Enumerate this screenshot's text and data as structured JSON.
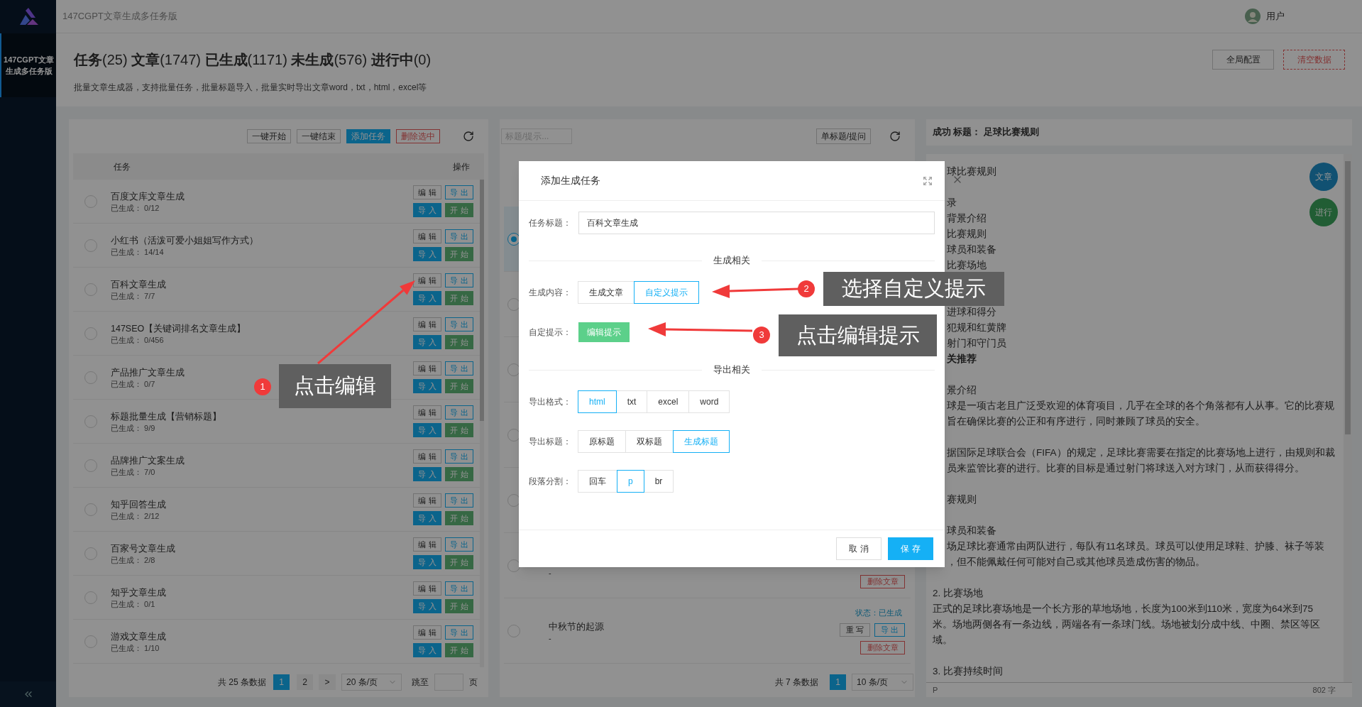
{
  "sidebar": {
    "items": [
      {
        "label": "147CGPT文章生成多任务版",
        "selected": true
      }
    ]
  },
  "topbar": {
    "title": "147CGPT文章生成多任务版",
    "user": "用户"
  },
  "header": {
    "stats": "**任务**(25) **文章**(1747) **已生成**(1171) **未生成**(576) **进行中**(0)",
    "description": "批量文章生成器，支持批量任务，批量标题导入，批量实时导出文章word，txt，html，excel等",
    "buttons": [
      {
        "label": "全局配置",
        "kind": "default"
      },
      {
        "label": "清空数据",
        "kind": "danger"
      }
    ]
  },
  "task_panel": {
    "toolbar": [
      {
        "label": "一键开始",
        "kind": "default"
      },
      {
        "label": "一键结束",
        "kind": "default"
      },
      {
        "label": "添加任务",
        "kind": "primary"
      },
      {
        "label": "删除选中",
        "kind": "danger"
      }
    ],
    "columns": [
      "任务",
      "操作"
    ],
    "rows": [
      {
        "name": "百度文库文章生成",
        "progress": "已生成： 0/12",
        "selected": false,
        "actions": [
          "编 辑",
          "导 出",
          "导 入",
          "开 始"
        ]
      },
      {
        "name": "小红书（活泼可爱小姐姐写作方式）",
        "progress": "已生成： 14/14",
        "selected": false,
        "actions": [
          "编 辑",
          "导 出",
          "导 入",
          "开 始"
        ]
      },
      {
        "name": "百科文章生成",
        "progress": "已生成： 7/7",
        "selected": false,
        "actions": [
          "编 辑",
          "导 出",
          "导 入",
          "开 始"
        ]
      },
      {
        "name": "147SEO【关键词排名文章生成】",
        "progress": "已生成： 0/456",
        "selected": false,
        "actions": [
          "编 辑",
          "导 出",
          "导 入",
          "开 始"
        ]
      },
      {
        "name": "产品推广文章生成",
        "progress": "已生成： 0/7",
        "selected": false,
        "actions": [
          "编 辑",
          "导 出",
          "导 入",
          "开 始"
        ]
      },
      {
        "name": "标题批量生成【营销标题】",
        "progress": "已生成： 9/9",
        "selected": false,
        "actions": [
          "编 辑",
          "导 出",
          "导 入",
          "开 始"
        ]
      },
      {
        "name": "品牌推广文案生成",
        "progress": "已生成： 7/0",
        "selected": false,
        "actions": [
          "编 辑",
          "导 出",
          "导 入",
          "开 始"
        ]
      },
      {
        "name": "知乎回答生成",
        "progress": "已生成： 2/12",
        "selected": false,
        "actions": [
          "编 辑",
          "导 出",
          "导 入",
          "开 始"
        ]
      },
      {
        "name": "百家号文章生成",
        "progress": "已生成： 2/8",
        "selected": false,
        "actions": [
          "编 辑",
          "导 出",
          "导 入",
          "开 始"
        ]
      },
      {
        "name": "知乎文章生成",
        "progress": "已生成： 0/1",
        "selected": false,
        "actions": [
          "编 辑",
          "导 出",
          "导 入",
          "开 始"
        ]
      },
      {
        "name": "游戏文章生成",
        "progress": "已生成： 1/10",
        "selected": false,
        "actions": [
          "编 辑",
          "导 出",
          "导 入",
          "开 始"
        ]
      }
    ],
    "pagination": {
      "total": "共 25 条数据",
      "pages": [
        {
          "label": "1",
          "selected": true
        },
        {
          "label": "2",
          "selected": false
        }
      ],
      "next": ">",
      "per_page": "20 条/页",
      "goto": "跳至",
      "suffix": "页"
    }
  },
  "article_panel": {
    "search": {
      "placeholder": "标题/提示..."
    },
    "button": "单标题/提问",
    "rows": [
      {
        "selected": true
      },
      {
        "selected": false
      },
      {
        "selected": false
      },
      {
        "selected": false
      },
      {
        "selected": false
      },
      {
        "selected": false,
        "subtitle": "-",
        "actions": [
          {
            "label": "删除文章",
            "kind": "delete"
          }
        ]
      },
      {
        "selected": false,
        "title": "中秋节的起源",
        "subtitle": "-",
        "status": "状态：已生成",
        "actions": [
          {
            "label": "重 写",
            "kind": "rewrite"
          },
          {
            "label": "导 出",
            "kind": "export"
          },
          {
            "label": "删除文章",
            "kind": "delete"
          }
        ]
      }
    ],
    "pagination": {
      "total": "共 7 条数据",
      "pages": [
        {
          "label": "1",
          "selected": true
        }
      ],
      "per_page": "10 条/页"
    }
  },
  "article": {
    "header": "成功 标题： 足球比赛规则",
    "paragraphs": [
      {
        "lines": [
          {
            "text": "球比赛规则",
            "cut": true,
            "bold": false
          }
        ]
      },
      {
        "lines": [
          {
            "text": "录",
            "cut": true,
            "bold": false
          },
          {
            "text": "背景介绍",
            "cut": true,
            "bold": false
          },
          {
            "text": "比赛规则",
            "cut": true,
            "bold": false
          },
          {
            "text": "球员和装备",
            "cut": true,
            "bold": false
          },
          {
            "text": "比赛场地",
            "cut": true,
            "bold": false
          }
        ]
      },
      {
        "lines": [
          {
            "text": "进球和得分",
            "cut": true,
            "bold": false
          },
          {
            "text": "犯规和红黄牌",
            "cut": true,
            "bold": false
          },
          {
            "text": "射门和守门员",
            "cut": true,
            "bold": false
          },
          {
            "text": "关推荐",
            "cut": true,
            "bold": true
          }
        ]
      },
      {
        "lines": [
          {
            "text": "景介绍",
            "cut": true,
            "bold": false
          },
          {
            "text": "球是一项古老且广泛受欢迎的体育项目，几乎在全球的各个角落都有人从事。它的比赛规",
            "cut": true,
            "bold": false
          },
          {
            "text": "旨在确保比赛的公正和有序进行，同时兼顾了球员的安全。",
            "cut": true,
            "bold": false
          }
        ]
      },
      {
        "lines": [
          {
            "text": "据国际足球联合会（FIFA）的规定，足球比赛需要在指定的比赛场地上进行，由规则和裁",
            "cut": true,
            "bold": false
          },
          {
            "text": "员来监管比赛的进行。比赛的目标是通过射门将球送入对方球门，从而获得得分。",
            "cut": true,
            "bold": false
          }
        ]
      },
      {
        "lines": [
          {
            "text": "赛规则",
            "cut": true,
            "bold": false
          }
        ]
      },
      {
        "lines": [
          {
            "text": "球员和装备",
            "cut": true,
            "bold": false
          },
          {
            "text": "场足球比赛通常由两队进行，每队有11名球员。球员可以使用足球鞋、护膝、袜子等装",
            "cut": true,
            "bold": false
          },
          {
            "text": "，但不能佩戴任何可能对自己或其他球员造成伤害的物品。",
            "cut": true,
            "bold": false
          }
        ]
      },
      {
        "lines": [
          {
            "text": "2. 比赛场地",
            "cut": false,
            "bold": false
          },
          {
            "text": "正式的足球比赛场地是一个长方形的草地场地，长度为100米到110米，宽度为64米到75",
            "cut": false,
            "bold": false
          },
          {
            "text": "米。场地两侧各有一条边线，两端各有一条球门线。场地被划分成中线、中圈、禁区等区",
            "cut": false,
            "bold": false
          },
          {
            "text": "域。",
            "cut": false,
            "bold": false
          }
        ]
      },
      {
        "lines": [
          {
            "text": "3. 比赛持续时间",
            "cut": false,
            "bold": false
          }
        ]
      }
    ],
    "footer_tag": "P",
    "word_count": "802 字",
    "floating_buttons": [
      {
        "label": "文章",
        "kind": "article"
      },
      {
        "label": "进行",
        "kind": "progress"
      }
    ]
  },
  "modal": {
    "title": "添加生成任务",
    "fields": [
      {
        "kind": "input",
        "label": "任务标题：",
        "value": "百科文章生成"
      },
      {
        "kind": "section",
        "label": "生成相关"
      },
      {
        "kind": "options",
        "label": "生成内容：",
        "options": [
          {
            "label": "生成文章",
            "selected": false
          },
          {
            "label": "自定义提示",
            "selected": true
          }
        ]
      },
      {
        "kind": "button",
        "label": "自定提示：",
        "button": "编辑提示"
      },
      {
        "kind": "section",
        "label": "导出相关"
      },
      {
        "kind": "options",
        "label": "导出格式：",
        "options": [
          {
            "label": "html",
            "selected": true
          },
          {
            "label": "txt",
            "selected": false
          },
          {
            "label": "excel",
            "selected": false
          },
          {
            "label": "word",
            "selected": false
          }
        ]
      },
      {
        "kind": "options",
        "label": "导出标题：",
        "options": [
          {
            "label": "原标题",
            "selected": false
          },
          {
            "label": "双标题",
            "selected": false
          },
          {
            "label": "生成标题",
            "selected": true
          }
        ]
      },
      {
        "kind": "options",
        "label": "段落分割：",
        "options": [
          {
            "label": "回车",
            "selected": false
          },
          {
            "label": "p",
            "selected": true
          },
          {
            "label": "br",
            "selected": false
          }
        ]
      }
    ],
    "buttons": [
      {
        "label": "取 消",
        "kind": "default"
      },
      {
        "label": "保 存",
        "kind": "primary"
      }
    ]
  },
  "annotations": [
    {
      "number": "1",
      "text": "点击编辑"
    },
    {
      "number": "2",
      "text": "选择自定义提示"
    },
    {
      "number": "3",
      "text": "点击编辑提示"
    }
  ]
}
